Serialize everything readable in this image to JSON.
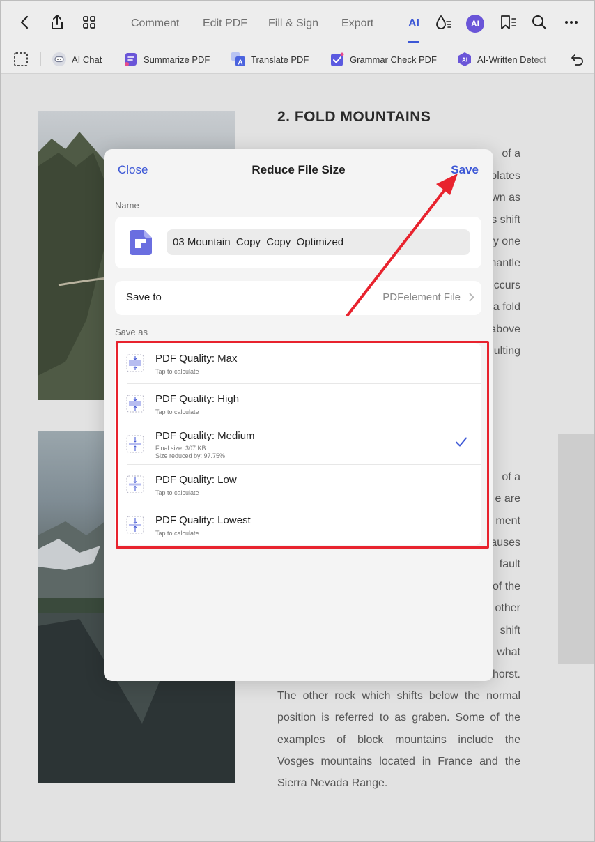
{
  "topbar": {
    "tabs": [
      {
        "label": "Comment"
      },
      {
        "label": "Edit PDF"
      },
      {
        "label": "Fill & Sign"
      },
      {
        "label": "Export"
      },
      {
        "label": "AI"
      }
    ],
    "ai_badge": "AI"
  },
  "toolbar": {
    "tools": [
      {
        "label": "AI Chat",
        "icon": "ai-chat-icon"
      },
      {
        "label": "Summarize PDF",
        "icon": "summarize-icon"
      },
      {
        "label": "Translate PDF",
        "icon": "translate-icon"
      },
      {
        "label": "Grammar Check PDF",
        "icon": "grammar-check-icon"
      },
      {
        "label": "AI-Written Detect",
        "icon": "ai-detect-icon"
      }
    ]
  },
  "document": {
    "heading": "2. FOLD MOUNTAINS",
    "right_fragments_top": [
      "of a",
      "plates",
      "own as",
      "s shift",
      "y one",
      "mantle",
      "ccurs",
      "a fold",
      "above",
      "ulting"
    ],
    "right_fragments_bottom": [
      "of a",
      "e are",
      "ment",
      "auses",
      "fault",
      "of the",
      "other",
      "shift",
      "what",
      "horst."
    ],
    "paragraph_lines": [
      "The other rock which shifts below the normal",
      "position is referred to as graben. Some of the",
      "examples of block mountains include the",
      "Vosges mountains located in France and the",
      "Sierra Nevada Range."
    ]
  },
  "dialog": {
    "close_label": "Close",
    "title": "Reduce File Size",
    "save_label": "Save",
    "name_label": "Name",
    "file_name": "03 Mountain_Copy_Copy_Optimized",
    "save_to_label": "Save to",
    "save_to_value": "PDFelement File",
    "save_as_label": "Save as",
    "quality_options": [
      {
        "title": "PDF Quality: Max",
        "subtitle": "Tap to calculate",
        "subtitle2": "",
        "selected": false
      },
      {
        "title": "PDF Quality: High",
        "subtitle": "Tap to calculate",
        "subtitle2": "",
        "selected": false
      },
      {
        "title": "PDF Quality: Medium",
        "subtitle": "Final size: 307 KB",
        "subtitle2": "Size reduced by: 97.75%",
        "selected": true
      },
      {
        "title": "PDF Quality: Low",
        "subtitle": "Tap to calculate",
        "subtitle2": "",
        "selected": false
      },
      {
        "title": "PDF Quality: Lowest",
        "subtitle": "Tap to calculate",
        "subtitle2": "",
        "selected": false
      }
    ]
  },
  "colors": {
    "accent": "#3c57d6",
    "annotation_red": "#e8232e",
    "ai_badge": "#6a55d8"
  }
}
